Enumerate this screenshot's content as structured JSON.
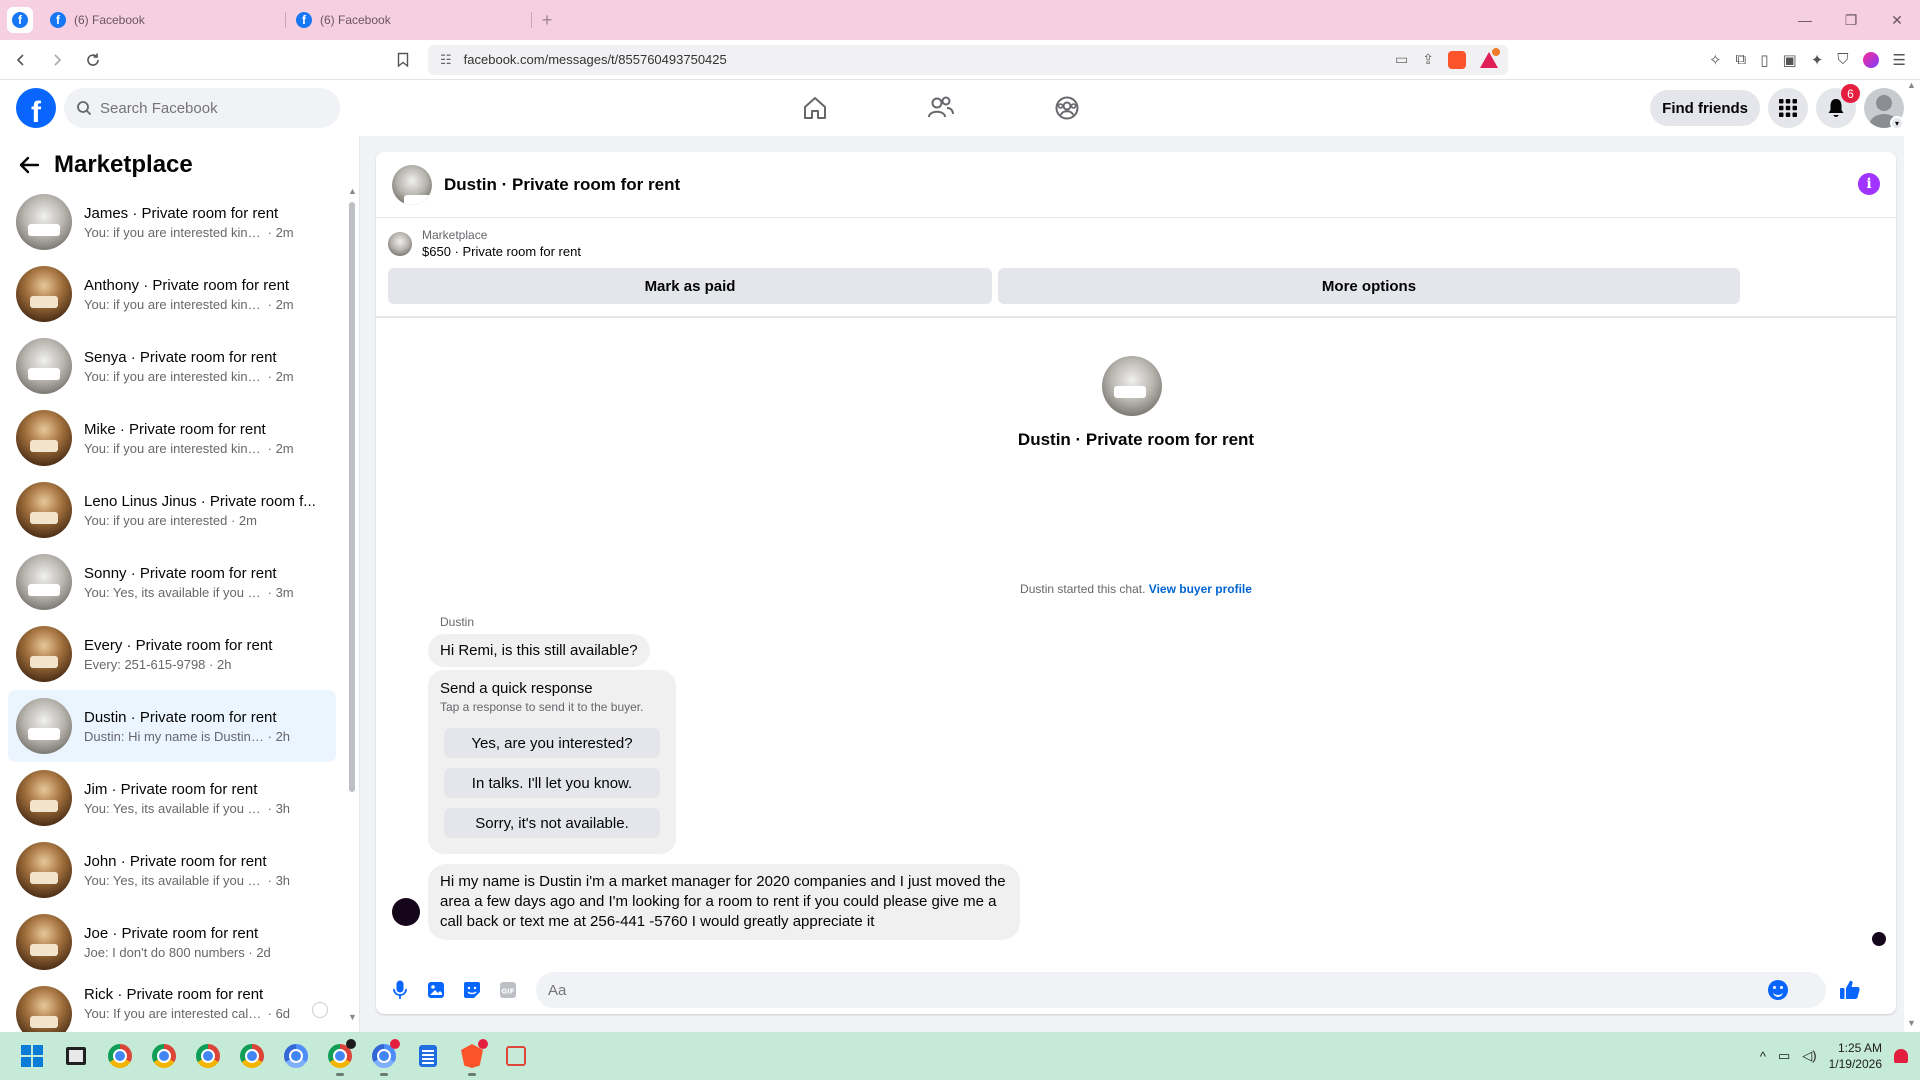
{
  "browser": {
    "tabs": [
      {
        "title": "(6) Facebook"
      },
      {
        "title": "(6) Facebook"
      }
    ],
    "url": "facebook.com/messages/t/855760493750425"
  },
  "facebook": {
    "logo": "f",
    "search_placeholder": "Search Facebook",
    "find_friends_label": "Find friends",
    "notification_count": "6",
    "nav_icons": [
      "home-icon",
      "friends-icon",
      "groups-icon"
    ]
  },
  "sidebar": {
    "title": "Marketplace",
    "conversations": [
      {
        "name": "James · Private room for rent",
        "snippet": "You: if you are interested kindly sh...",
        "time": "2m",
        "thumb": "grey"
      },
      {
        "name": "Anthony · Private room for rent",
        "snippet": "You: if you are interested kindly sh...",
        "time": "2m",
        "thumb": "warm"
      },
      {
        "name": "Senya · Private room for rent",
        "snippet": "You: if you are interested kindly sh...",
        "time": "2m",
        "thumb": "grey"
      },
      {
        "name": "Mike · Private room for rent",
        "snippet": "You: if you are interested kindly sh...",
        "time": "2m",
        "thumb": "warm"
      },
      {
        "name": "Leno Linus Jinus · Private room f...",
        "snippet": "You: if you are interested",
        "time": "2m",
        "thumb": "warm"
      },
      {
        "name": "Sonny · Private room for rent",
        "snippet": "You: Yes, its available if you are int...",
        "time": "3m",
        "thumb": "grey"
      },
      {
        "name": "Every · Private room for rent",
        "snippet": "Every: 251-615-9798",
        "time": "2h",
        "thumb": "warm"
      },
      {
        "name": "Dustin · Private room for rent",
        "snippet": "Dustin: Hi my name is Dustin i'm a ...",
        "time": "2h",
        "thumb": "grey"
      },
      {
        "name": "Jim · Private room for rent",
        "snippet": "You: Yes, its available if you are inte...",
        "time": "3h",
        "thumb": "warm"
      },
      {
        "name": "John · Private room for rent",
        "snippet": "You: Yes, its available if you are inte...",
        "time": "3h",
        "thumb": "warm"
      },
      {
        "name": "Joe · Private room for rent",
        "snippet": "Joe: I don't do 800 numbers",
        "time": "2d",
        "thumb": "warm"
      },
      {
        "name": "Rick · Private room for rent",
        "snippet": "You: If you are interested call me...",
        "time": "6d",
        "thumb": "warm"
      }
    ]
  },
  "chat": {
    "header_title": "Dustin · Private room for rent",
    "listing_label": "Marketplace",
    "listing_price": "$650 · Private room for rent",
    "mark_paid_label": "Mark as paid",
    "more_options_label": "More options",
    "intro_name": "Dustin · Private room for rent",
    "started_text": "Dustin started this chat.",
    "view_profile_label": "View buyer profile",
    "sender_name": "Dustin",
    "message_1": "Hi Remi, is this still available?",
    "quick_title": "Send a quick response",
    "quick_subtitle": "Tap a response to send it to the buyer.",
    "quick_responses": [
      "Yes, are you interested?",
      "In talks. I'll let you know.",
      "Sorry, it's not available."
    ],
    "message_2": "Hi my name is Dustin i'm a market manager for 2020 companies and I just moved the area a few days ago and I'm looking for a room to rent if you could please give me a call back or text me at 256-441 -5760 I would greatly appreciate it",
    "composer_placeholder": "Aa"
  },
  "taskbar": {
    "time": "1:25 AM",
    "date": "1/19/2026"
  },
  "colors": {
    "tabstrip": "#f6cfe0",
    "fb_blue": "#0866ff",
    "taskbar": "#c6ead8",
    "active_convo": "#ebf5ff",
    "info_purple": "#a033ff"
  }
}
